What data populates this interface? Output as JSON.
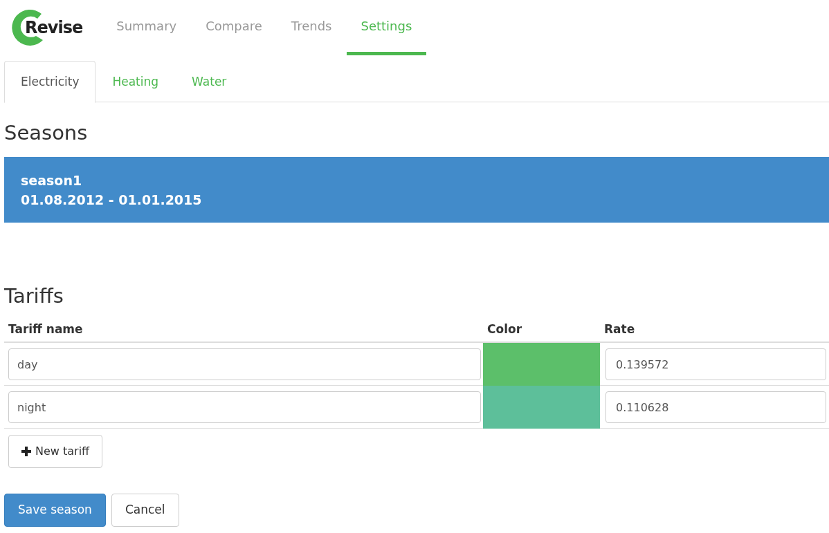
{
  "logo": {
    "text": "Revise"
  },
  "nav": [
    {
      "label": "Summary",
      "selected": false
    },
    {
      "label": "Compare",
      "selected": false
    },
    {
      "label": "Trends",
      "selected": false
    },
    {
      "label": "Settings",
      "selected": true
    }
  ],
  "tabs": [
    {
      "label": "Electricity",
      "selected": true
    },
    {
      "label": "Heating",
      "selected": false
    },
    {
      "label": "Water",
      "selected": false
    }
  ],
  "seasons": {
    "title": "Seasons",
    "items": [
      {
        "name": "season1",
        "dates": "01.08.2012 - 01.01.2015",
        "selected": true
      }
    ]
  },
  "tariffs": {
    "title": "Tariffs",
    "columns": [
      "Tariff name",
      "Color",
      "Rate"
    ],
    "rows": [
      {
        "name": "day",
        "color": "#5cbf6a",
        "rate": "0.139572"
      },
      {
        "name": "night",
        "color": "#5dbf9a",
        "rate": "0.110628"
      }
    ],
    "add_button": "New tariff"
  },
  "buttons": [
    {
      "label": "Save season",
      "kind": "primary"
    },
    {
      "label": "Cancel",
      "kind": "default"
    }
  ]
}
